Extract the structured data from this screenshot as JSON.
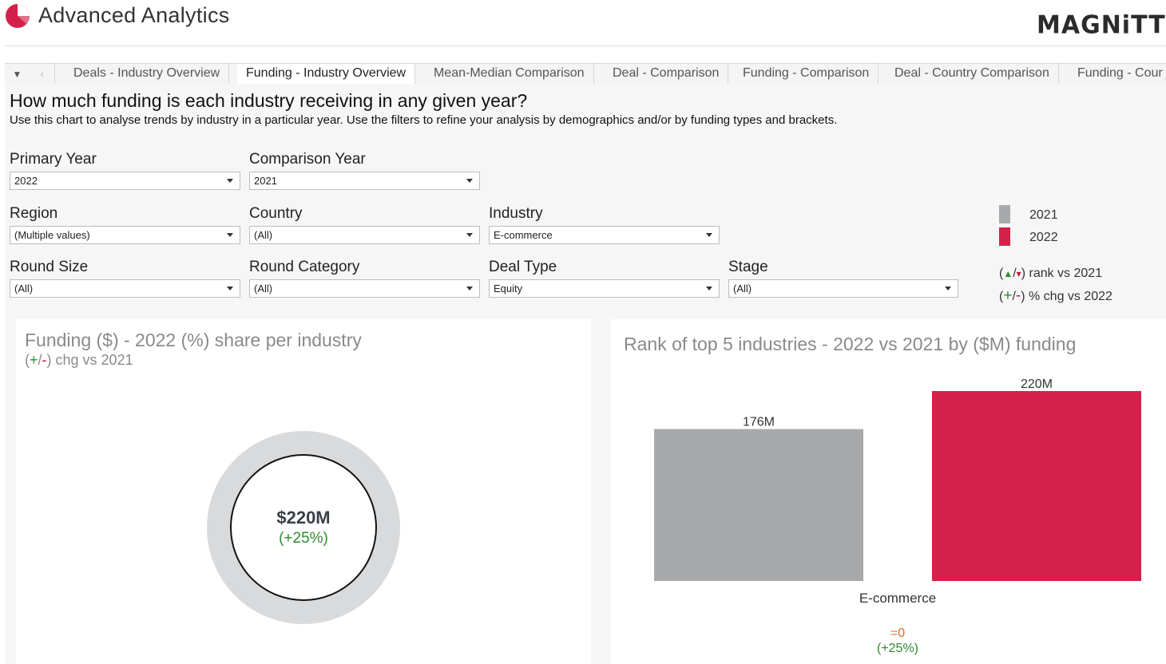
{
  "app": {
    "title": "Advanced Analytics",
    "brand": "MAGNiTT"
  },
  "tabs": [
    {
      "label": "Deals - Industry Overview",
      "active": false
    },
    {
      "label": "Funding - Industry Overview",
      "active": true
    },
    {
      "label": "Mean-Median Comparison",
      "active": false
    },
    {
      "label": "Deal - Comparison",
      "active": false
    },
    {
      "label": "Funding - Comparison",
      "active": false
    },
    {
      "label": "Deal - Country Comparison",
      "active": false
    },
    {
      "label": "Funding - Cour",
      "active": false
    }
  ],
  "header": {
    "question": "How much funding is each industry receiving in any given year?",
    "instructions": "Use this chart to analyse trends by industry in a particular year. Use the filters to refine your analysis by demographics and/or by funding types and brackets."
  },
  "filters": {
    "primary_year": {
      "label": "Primary Year",
      "value": "2022"
    },
    "comparison_year": {
      "label": "Comparison Year",
      "value": "2021"
    },
    "region": {
      "label": "Region",
      "value": "(Multiple values)"
    },
    "country": {
      "label": "Country",
      "value": "(All)"
    },
    "industry": {
      "label": "Industry",
      "value": "E-commerce"
    },
    "round_size": {
      "label": "Round Size",
      "value": "(All)"
    },
    "round_category": {
      "label": "Round Category",
      "value": "(All)"
    },
    "deal_type": {
      "label": "Deal Type",
      "value": "Equity"
    },
    "stage": {
      "label": "Stage",
      "value": "(All)"
    }
  },
  "legend": {
    "items": [
      {
        "label": "2021",
        "color": "#a8a9aa"
      },
      {
        "label": "2022",
        "color": "#d4214a"
      }
    ],
    "rank_open": "(",
    "rank_up": "▲",
    "rank_sep": "/",
    "rank_down": "▾",
    "rank_close": ")",
    "rank_text": "rank vs 2021",
    "chg_open": "(",
    "chg_plus": "+",
    "chg_sep": "/",
    "chg_minus": "-",
    "chg_close": ")",
    "chg_text": "% chg vs 2022"
  },
  "donut_panel": {
    "title": "Funding ($) - 2022  (%) share per industry",
    "sub_open": "(",
    "sub_plus": "+",
    "sub_sep": "/",
    "sub_minus": "-",
    "sub_rest": ") chg vs 2021",
    "center_value": "$220M",
    "center_change": "(+25%)",
    "share": 1.0,
    "ring_color": "#d9dadb"
  },
  "chart_data": {
    "type": "bar",
    "title": "Rank of top 5 industries - 2022 vs 2021 by ($M) funding",
    "categories": [
      "E-commerce"
    ],
    "series": [
      {
        "name": "2021",
        "values": [
          176
        ],
        "labels": [
          "176M"
        ],
        "color": "#a8a9aa"
      },
      {
        "name": "2022",
        "values": [
          220
        ],
        "labels": [
          "220M"
        ],
        "color": "#d4214a"
      }
    ],
    "annotations": {
      "rank_change": "=0",
      "pct_change": "(+25%)"
    },
    "ylim": [
      0,
      220
    ]
  }
}
